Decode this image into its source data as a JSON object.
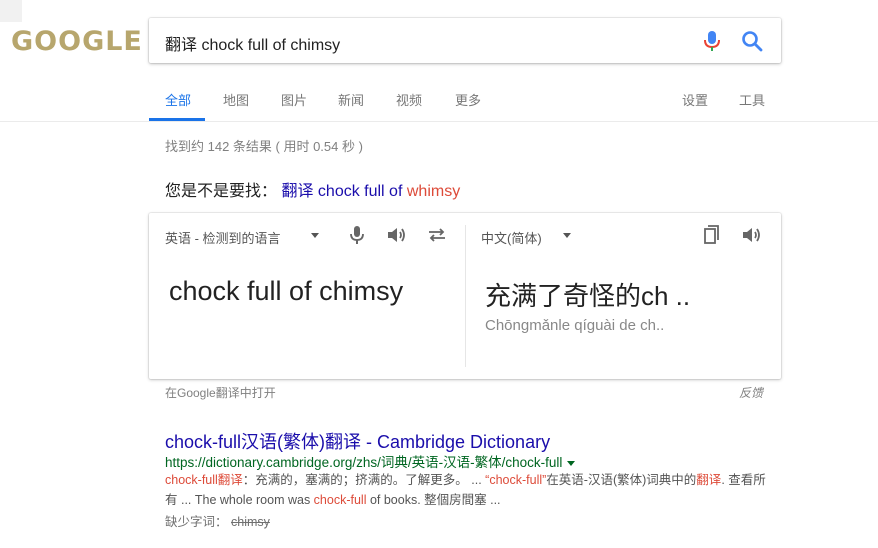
{
  "logo": {
    "text": "GOOGLE"
  },
  "search": {
    "query": "翻译  chock full of chimsy"
  },
  "tabs": [
    {
      "label": "全部"
    },
    {
      "label": "地图"
    },
    {
      "label": "图片"
    },
    {
      "label": "新闻"
    },
    {
      "label": "视频"
    },
    {
      "label": "更多"
    }
  ],
  "tools": {
    "settings": "设置",
    "tools": "工具"
  },
  "stats": "找到约 142 条结果  ( 用时 0.54 秒 )",
  "did_you_mean": {
    "prefix": "您是不是要找：",
    "link_prefix": "翻译 chock full of",
    "corrected": "whimsy"
  },
  "translate": {
    "source_lang": "英语 - 检测到的语言",
    "target_lang": "中文(简体)",
    "source_text": "chock full of chimsy",
    "target_text": "充满了奇怪的ch ..",
    "target_romanization": "Chōngmǎnle qíguài de ch..",
    "open_link": "在Google翻译中打开",
    "feedback": "反馈"
  },
  "result": {
    "title": "chock-full汉语(繁体)翻译 - Cambridge Dictionary",
    "url": "https://dictionary.cambridge.org/zhs/词典/英语-汉语-繁体/chock-full",
    "snippet_parts": {
      "a_em": "chock-full翻译",
      "b": "：充满的，塞满的；挤满的。了解更多。 ... ",
      "c_em": "“chock-full”",
      "d": "在英语-汉语(繁体)词典中的",
      "e_em": "翻译",
      "f": ". 查看所有 ... The whole room was ",
      "g_em": "chock-full",
      "h": " of books. 整個房間塞 ..."
    },
    "missing_label": "缺少字词：",
    "missing_word": "chimsy"
  },
  "colors": {
    "link": "#1a0dab",
    "url": "#006621",
    "accent": "#1a73e8",
    "highlight": "#dd4b39",
    "logo": "#b7a66d"
  }
}
